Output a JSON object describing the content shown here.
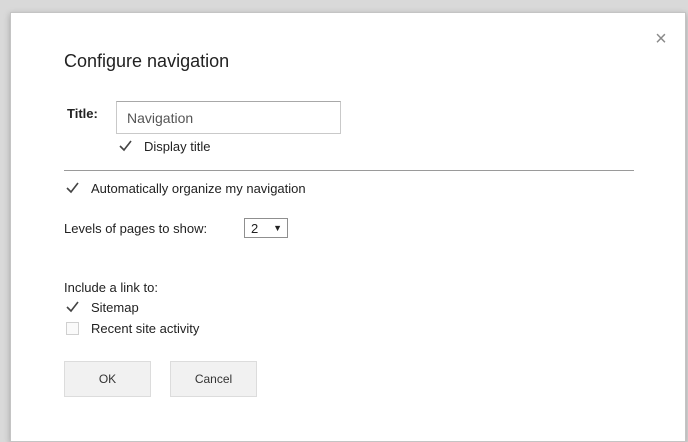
{
  "dialog": {
    "title": "Configure navigation",
    "close_glyph": "×"
  },
  "title_field": {
    "label": "Title:",
    "value": "Navigation",
    "display_title_label": "Display title",
    "display_title_checked": true
  },
  "auto_organize": {
    "label": "Automatically organize my navigation",
    "checked": true
  },
  "levels": {
    "label": "Levels of pages to show:",
    "selected": "2",
    "arrow": "▼"
  },
  "include": {
    "heading": "Include a link to:",
    "sitemap_label": "Sitemap",
    "sitemap_checked": true,
    "recent_label": "Recent site activity",
    "recent_checked": false
  },
  "buttons": {
    "ok": "OK",
    "cancel": "Cancel"
  }
}
